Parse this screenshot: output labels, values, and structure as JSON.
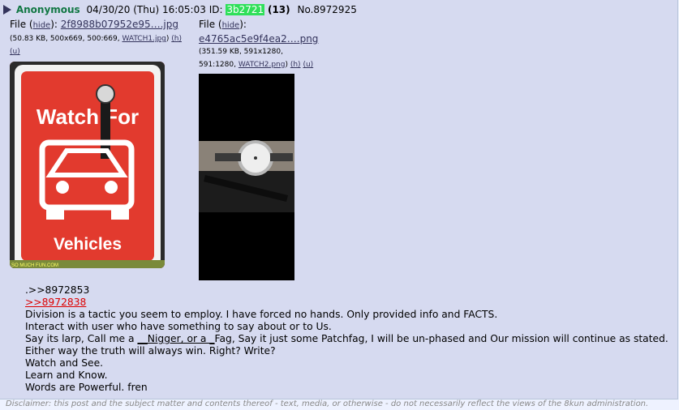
{
  "header": {
    "name": "Anonymous",
    "date": "04/30/20 (Thu) 16:05:03",
    "id_label": "ID:",
    "id_value": "3b2721",
    "reply_count": "(13)",
    "post_number": "No.8972925"
  },
  "files": [
    {
      "label": "File (",
      "hide": "hide",
      "label_end": "):",
      "filename": "2f8988b07952e95….jpg",
      "meta_open": "(50.83 KB, 500x669, 500:669,",
      "orig_name": "WATCH1.jpg",
      "h": "(h)",
      "u": "(u)",
      "image": {
        "top_text": "Watch For",
        "bottom_text": "Vehicles",
        "corner_text": "SO MUCH FUN.COM"
      }
    },
    {
      "label": "File (",
      "hide": "hide",
      "label_end": "):",
      "filename": "e4765ac5e9f4ea2….png",
      "meta_open": "(351.59 KB, 591x1280,",
      "meta_line2": "591:1280,",
      "orig_name": "WATCH2.png",
      "h": "(h)",
      "u": "(u)"
    }
  ],
  "body": {
    "line1": ".>>8972853",
    "line2": ">>8972838",
    "line3": "Division is a tactic you seem to employ. I have forced no hands. Only provided info and FACTS.",
    "line4": "Interact with user who have something to say about or to Us.",
    "line5a": "Say its larp, Call me a ",
    "line5b": "__Nigger, or a _",
    "line5c": "Fag, Say it just some Patchfag, I will be un-phased and Our mission will continue as stated.",
    "line6": "Either way the truth will always win. Right? Write?",
    "line7": "Watch and See.",
    "line8": "Learn and Know.",
    "line9": "Words are Powerful. fren"
  },
  "disclaimer": "Disclaimer: this post and the subject matter and contents thereof - text, media, or otherwise - do not necessarily reflect the views of the 8kun administration."
}
